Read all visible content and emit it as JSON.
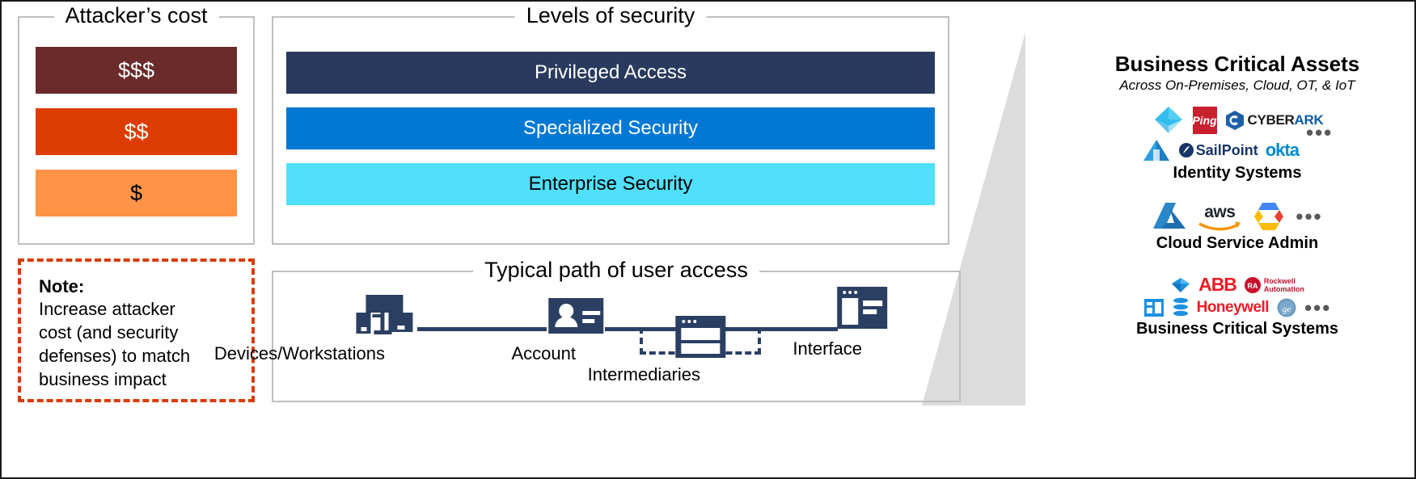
{
  "diagram": {
    "title": "Levels of security / privileged access layered defense diagram"
  },
  "attacker_cost": {
    "title": "Attacker’s cost",
    "bars": [
      {
        "label": "$$$",
        "color": "#6B2B2B",
        "text_color": "#ffffff"
      },
      {
        "label": "$$",
        "color": "#DC3C00",
        "text_color": "#ffffff"
      },
      {
        "label": "$",
        "color": "#FF9447",
        "text_color": "#000000"
      }
    ]
  },
  "note": {
    "title": "Note:",
    "lines": [
      "Increase attacker",
      "cost (and security",
      "defenses) to match",
      "business impact"
    ],
    "border_color": "#d83b01"
  },
  "levels_of_security": {
    "title": "Levels of security",
    "bars": [
      {
        "label": "Privileged Access",
        "color": "#293A5E",
        "text_color": "#ffffff"
      },
      {
        "label": "Specialized Security",
        "color": "#0078D4",
        "text_color": "#ffffff"
      },
      {
        "label": "Enterprise Security",
        "color": "#50E0FC",
        "text_color": "#000000"
      }
    ]
  },
  "user_access_path": {
    "title": "Typical path of user access",
    "nodes": [
      {
        "label": "Devices/Workstations",
        "icon": "workstation-icon"
      },
      {
        "label": "Account",
        "icon": "account-badge-icon"
      },
      {
        "label": "Intermediaries",
        "icon": "window-stack-icon"
      },
      {
        "label": "Interface",
        "icon": "app-window-icon"
      }
    ],
    "line_color": "#2b3f63"
  },
  "business_critical_assets": {
    "title": "Business Critical Assets",
    "subtitle": "Across On-Premises, Cloud, OT, & IoT",
    "groups": [
      {
        "label": "Identity Systems",
        "ellipsis": "•••",
        "rows": [
          [
            {
              "name": "azure-ad-icon",
              "text": ""
            },
            {
              "name": "ping-identity-logo",
              "text": "Ping"
            },
            {
              "name": "cyberark-logo",
              "text": "CYBER",
              "text2": "ARK"
            }
          ],
          [
            {
              "name": "oracle-pyramid-icon",
              "text": ""
            },
            {
              "name": "sailpoint-logo",
              "text": "SailPoint"
            },
            {
              "name": "okta-logo",
              "text": "okta"
            }
          ]
        ]
      },
      {
        "label": "Cloud Service Admin",
        "ellipsis": "•••",
        "rows": [
          [
            {
              "name": "azure-logo",
              "text": ""
            },
            {
              "name": "aws-logo",
              "text": "aws"
            },
            {
              "name": "google-cloud-logo",
              "text": ""
            }
          ]
        ]
      },
      {
        "label": "Business Critical Systems",
        "ellipsis": "•••",
        "rows": [
          [
            {
              "name": "sap-diamond-icon",
              "text": ""
            },
            {
              "name": "abb-logo",
              "text": "ABB"
            },
            {
              "name": "rockwell-automation-logo",
              "text": "Rockwell",
              "text2": "Automation"
            }
          ],
          [
            {
              "name": "dynamics-icon",
              "text": ""
            },
            {
              "name": "oracle-db-icon",
              "text": ""
            },
            {
              "name": "honeywell-logo",
              "text": "Honeywell"
            },
            {
              "name": "ge-logo",
              "text": ""
            }
          ]
        ]
      }
    ]
  },
  "colors": {
    "frame": "#bfbfbf",
    "funnel": "#dcdcdc",
    "dark_navy": "#2b3f63",
    "outer_border": "#1a1a1a"
  }
}
